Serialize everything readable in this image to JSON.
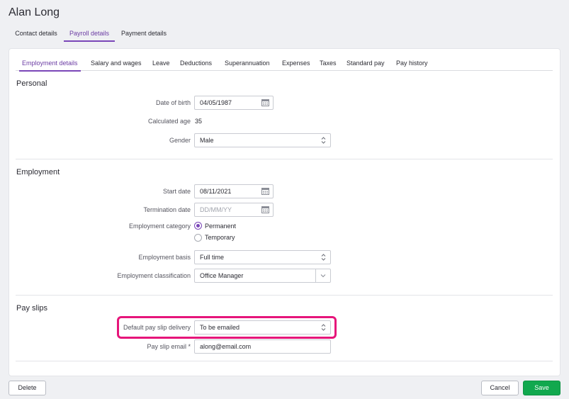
{
  "page": {
    "title": "Alan Long"
  },
  "top_tabs": [
    {
      "label": "Contact details",
      "active": false
    },
    {
      "label": "Payroll details",
      "active": true
    },
    {
      "label": "Payment details",
      "active": false
    }
  ],
  "sub_tabs": [
    {
      "label": "Employment details",
      "active": true
    },
    {
      "label": "Salary and wages",
      "active": false
    },
    {
      "label": "Leave",
      "active": false
    },
    {
      "label": "Deductions",
      "active": false
    },
    {
      "label": "Superannuation",
      "active": false
    },
    {
      "label": "Expenses",
      "active": false
    },
    {
      "label": "Taxes",
      "active": false
    },
    {
      "label": "Standard pay",
      "active": false
    },
    {
      "label": "Pay history",
      "active": false
    }
  ],
  "personal": {
    "title": "Personal",
    "dob_label": "Date of birth",
    "dob_value": "04/05/1987",
    "age_label": "Calculated age",
    "age_value": "35",
    "gender_label": "Gender",
    "gender_value": "Male"
  },
  "employment": {
    "title": "Employment",
    "start_label": "Start date",
    "start_value": "08/11/2021",
    "termination_label": "Termination date",
    "termination_placeholder": "DD/MM/YY",
    "category_label": "Employment category",
    "category_options": [
      {
        "label": "Permanent",
        "checked": true
      },
      {
        "label": "Temporary",
        "checked": false
      }
    ],
    "basis_label": "Employment basis",
    "basis_value": "Full time",
    "classification_label": "Employment classification",
    "classification_value": "Office Manager"
  },
  "payslips": {
    "title": "Pay slips",
    "delivery_label": "Default pay slip delivery",
    "delivery_value": "To be emailed",
    "email_label": "Pay slip email *",
    "email_value": "along@email.com"
  },
  "footer": {
    "delete_label": "Delete",
    "cancel_label": "Cancel",
    "save_label": "Save"
  },
  "colors": {
    "accent": "#7a46b8",
    "highlight": "#e6157a",
    "primary_button": "#11a84e"
  },
  "icons": {
    "calendar": "calendar-icon",
    "select": "updown-chevron-icon",
    "combo": "chevron-down-icon"
  }
}
